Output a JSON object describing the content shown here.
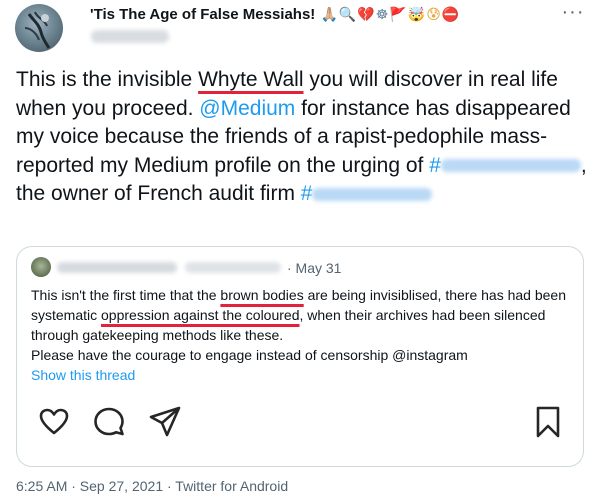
{
  "author": {
    "display_name": "'Tis The Age of False Messiahs! ",
    "emojis": [
      "🙏🏼",
      "🔍",
      "💔",
      "☸",
      "🚩",
      "🤯",
      "😰",
      "⛔"
    ]
  },
  "header": {
    "more_label": "···"
  },
  "tweet": {
    "seg1": "This is the invisible ",
    "whyte_wall": "Whyte Wall",
    "seg2": " you will discover in real life when you proceed. ",
    "medium_mention": "@Medium",
    "seg3": " for instance has disappeared my voice because the friends of a rapist-pedophile mass-reported my Medium profile on the urging of ",
    "hash1": "#",
    "seg4": ", the owner of French audit firm ",
    "hash2": "#"
  },
  "quoted": {
    "date": "· May 31",
    "t1": "This isn't the first time that the ",
    "brown_bodies": "brown bodies",
    "t2": " are being invisiblised, there has had been systematic ",
    "oppression": "oppression against the coloured",
    "t3": ", when their archives had been silenced through gatekeeping methods like these.",
    "t4": "Please have the courage to engage instead of censorship @instagram",
    "show_thread": "Show this thread"
  },
  "actions": [
    "heart-icon",
    "comment-icon",
    "share-icon",
    "bookmark-icon"
  ],
  "meta": "6:25 AM · Sep 27, 2021 · Twitter for Android"
}
